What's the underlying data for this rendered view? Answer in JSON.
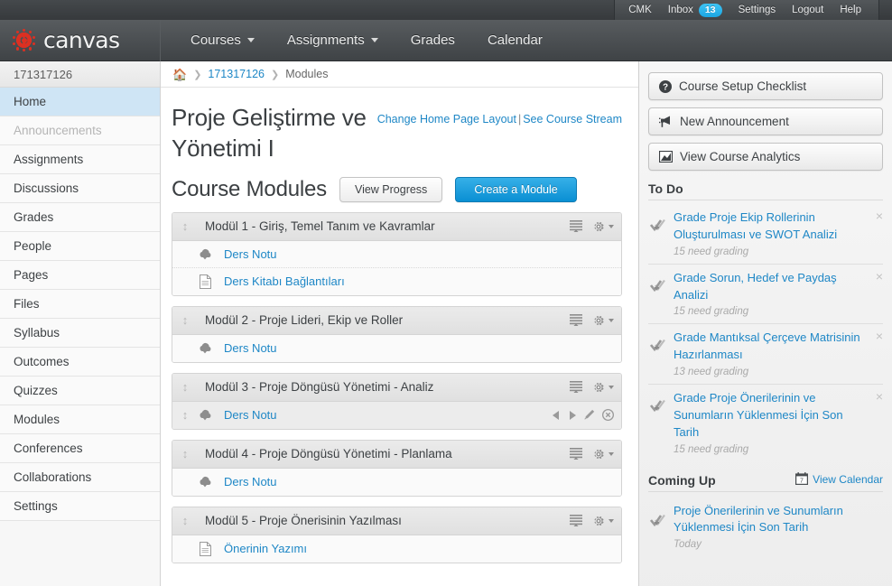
{
  "top_bar": {
    "user": "CMK",
    "inbox_label": "Inbox",
    "inbox_count": "13",
    "settings": "Settings",
    "logout": "Logout",
    "help": "Help"
  },
  "header": {
    "wordmark": "canvas",
    "nav": [
      {
        "label": "Courses",
        "has_caret": true
      },
      {
        "label": "Assignments",
        "has_caret": true
      },
      {
        "label": "Grades",
        "has_caret": false
      },
      {
        "label": "Calendar",
        "has_caret": false
      }
    ]
  },
  "course_nav": {
    "course_code": "171317126",
    "items": [
      {
        "label": "Home",
        "state": "active"
      },
      {
        "label": "Announcements",
        "state": "disabled"
      },
      {
        "label": "Assignments",
        "state": "normal"
      },
      {
        "label": "Discussions",
        "state": "normal"
      },
      {
        "label": "Grades",
        "state": "normal"
      },
      {
        "label": "People",
        "state": "normal"
      },
      {
        "label": "Pages",
        "state": "normal"
      },
      {
        "label": "Files",
        "state": "normal"
      },
      {
        "label": "Syllabus",
        "state": "normal"
      },
      {
        "label": "Outcomes",
        "state": "normal"
      },
      {
        "label": "Quizzes",
        "state": "normal"
      },
      {
        "label": "Modules",
        "state": "normal"
      },
      {
        "label": "Conferences",
        "state": "normal"
      },
      {
        "label": "Collaborations",
        "state": "normal"
      },
      {
        "label": "Settings",
        "state": "normal"
      }
    ]
  },
  "breadcrumb": {
    "home_icon": "home-icon",
    "course": "171317126",
    "current": "Modules"
  },
  "main": {
    "course_title": "Proje Geliştirme ve Yönetimi I",
    "change_layout_link": "Change Home Page Layout",
    "separator": "|",
    "course_stream_link": "See Course Stream",
    "modules_heading": "Course Modules",
    "view_progress_button": "View Progress",
    "create_module_button": "Create a Module",
    "modules": [
      {
        "title": "Modül 1 - Giriş, Temel Tanım ve Kavramlar",
        "items": [
          {
            "title": "Ders Notu",
            "icon": "cloud-download-icon",
            "active": false
          },
          {
            "title": "Ders Kitabı Bağlantıları",
            "icon": "document-icon",
            "active": false
          }
        ]
      },
      {
        "title": "Modül 2 - Proje Lideri, Ekip ve Roller",
        "items": [
          {
            "title": "Ders Notu",
            "icon": "cloud-download-icon",
            "active": false
          }
        ]
      },
      {
        "title": "Modül 3 - Proje Döngüsü Yönetimi - Analiz",
        "items": [
          {
            "title": "Ders Notu",
            "icon": "cloud-download-icon",
            "active": true
          }
        ]
      },
      {
        "title": "Modül 4 - Proje Döngüsü Yönetimi - Planlama",
        "items": [
          {
            "title": "Ders Notu",
            "icon": "cloud-download-icon",
            "active": false
          }
        ]
      },
      {
        "title": "Modül 5 - Proje Önerisinin Yazılması",
        "items": [
          {
            "title": "Önerinin Yazımı",
            "icon": "document-icon",
            "active": false
          }
        ]
      }
    ]
  },
  "sidebar": {
    "buttons": [
      {
        "label": "Course Setup Checklist",
        "icon": "question-circle-icon"
      },
      {
        "label": "New Announcement",
        "icon": "megaphone-icon"
      },
      {
        "label": "View Course Analytics",
        "icon": "chart-image-icon"
      }
    ],
    "todo_heading": "To Do",
    "todo_items": [
      {
        "title": "Grade Proje Ekip Rollerinin Oluşturulması ve SWOT Analizi",
        "meta": "15 need grading"
      },
      {
        "title": "Grade Sorun, Hedef ve Paydaş Analizi",
        "meta": "15 need grading"
      },
      {
        "title": "Grade Mantıksal Çerçeve Matrisinin Hazırlanması",
        "meta": "13 need grading"
      },
      {
        "title": "Grade Proje Önerilerinin ve Sunumların Yüklenmesi İçin Son Tarih",
        "meta": "15 need grading"
      }
    ],
    "coming_up_heading": "Coming Up",
    "view_calendar_link": "View Calendar",
    "calendar_day": "7",
    "coming_up_items": [
      {
        "title": "Proje Önerilerinin ve Sunumların Yüklenmesi İçin Son Tarih",
        "meta": "Today"
      }
    ]
  },
  "colors": {
    "accent_blue": "#1e87c6",
    "primary_button": "#0a8fd3",
    "badge_blue": "#29b6f0",
    "logo_red": "#dc3022",
    "active_nav": "#cfe5f5"
  }
}
